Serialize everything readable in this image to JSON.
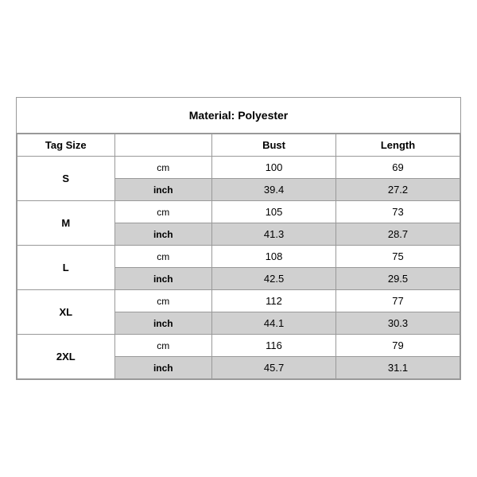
{
  "title": "Material: Polyester",
  "headers": {
    "tag_size": "Tag Size",
    "bust": "Bust",
    "length": "Length"
  },
  "sizes": [
    {
      "tag": "S",
      "cm": {
        "bust": "100",
        "length": "69"
      },
      "inch": {
        "bust": "39.4",
        "length": "27.2"
      }
    },
    {
      "tag": "M",
      "cm": {
        "bust": "105",
        "length": "73"
      },
      "inch": {
        "bust": "41.3",
        "length": "28.7"
      }
    },
    {
      "tag": "L",
      "cm": {
        "bust": "108",
        "length": "75"
      },
      "inch": {
        "bust": "42.5",
        "length": "29.5"
      }
    },
    {
      "tag": "XL",
      "cm": {
        "bust": "112",
        "length": "77"
      },
      "inch": {
        "bust": "44.1",
        "length": "30.3"
      }
    },
    {
      "tag": "2XL",
      "cm": {
        "bust": "116",
        "length": "79"
      },
      "inch": {
        "bust": "45.7",
        "length": "31.1"
      }
    }
  ],
  "units": {
    "cm": "cm",
    "inch": "inch"
  }
}
